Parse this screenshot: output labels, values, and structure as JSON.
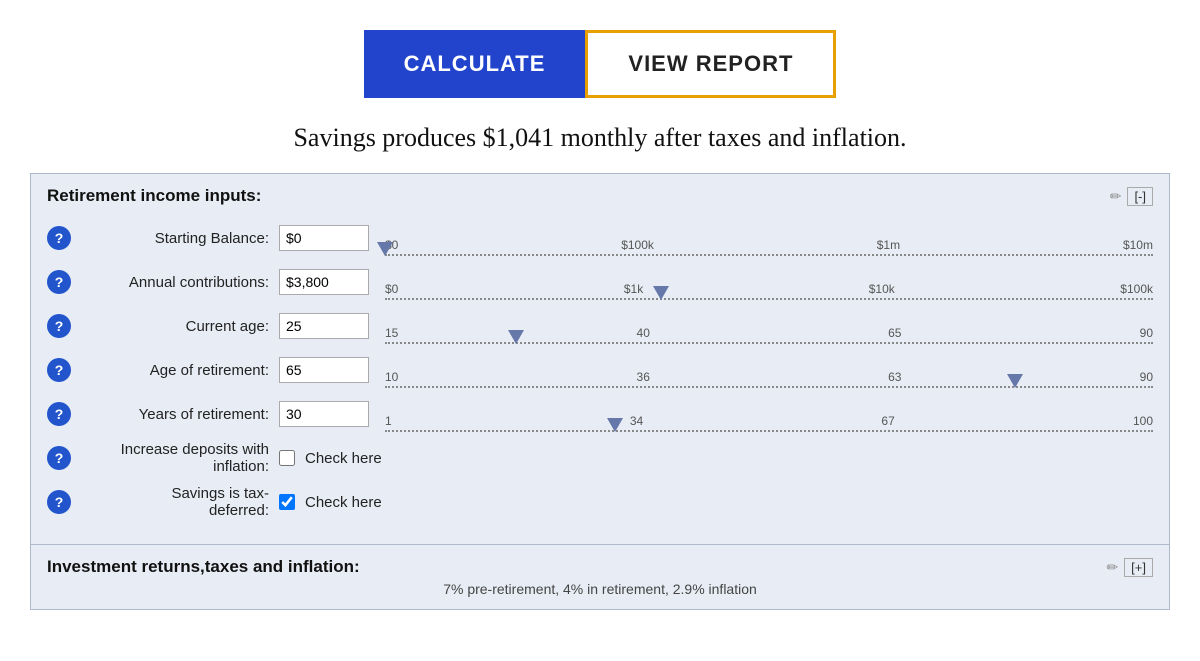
{
  "buttons": {
    "calculate": "CALCULATE",
    "view_report": "VIEW REPORT"
  },
  "summary": "Savings produces $1,041 monthly after taxes and inflation.",
  "retirement_section": {
    "title": "Retirement income inputs:",
    "collapse_label": "[-]",
    "edit_icon": "✏",
    "fields": [
      {
        "label": "Starting Balance:",
        "value": "$0",
        "slider_labels": [
          "$0",
          "$100k",
          "$1m",
          "$10m"
        ],
        "thumb_pct": 0,
        "id": "starting-balance"
      },
      {
        "label": "Annual contributions:",
        "value": "$3,800",
        "slider_labels": [
          "$0",
          "$1k",
          "$10k",
          "$100k"
        ],
        "thumb_pct": 36,
        "id": "annual-contributions"
      },
      {
        "label": "Current age:",
        "value": "25",
        "slider_labels": [
          "15",
          "40",
          "65",
          "90"
        ],
        "thumb_pct": 17,
        "id": "current-age"
      },
      {
        "label": "Age of retirement:",
        "value": "65",
        "slider_labels": [
          "10",
          "36",
          "63",
          "90"
        ],
        "thumb_pct": 82,
        "id": "age-of-retirement"
      },
      {
        "label": "Years of retirement:",
        "value": "30",
        "slider_labels": [
          "1",
          "34",
          "67",
          "100"
        ],
        "thumb_pct": 30,
        "id": "years-of-retirement"
      }
    ],
    "checkboxes": [
      {
        "label": "Increase deposits with inflation:",
        "checked": false,
        "check_text": "Check here",
        "id": "increase-deposits"
      },
      {
        "label": "Savings is tax-deferred:",
        "checked": true,
        "check_text": "Check here",
        "id": "tax-deferred"
      }
    ]
  },
  "investment_section": {
    "title": "Investment returns,taxes and inflation:",
    "expand_label": "[+]",
    "edit_icon": "✏",
    "subtitle": "7% pre-retirement, 4% in retirement, 2.9% inflation"
  }
}
